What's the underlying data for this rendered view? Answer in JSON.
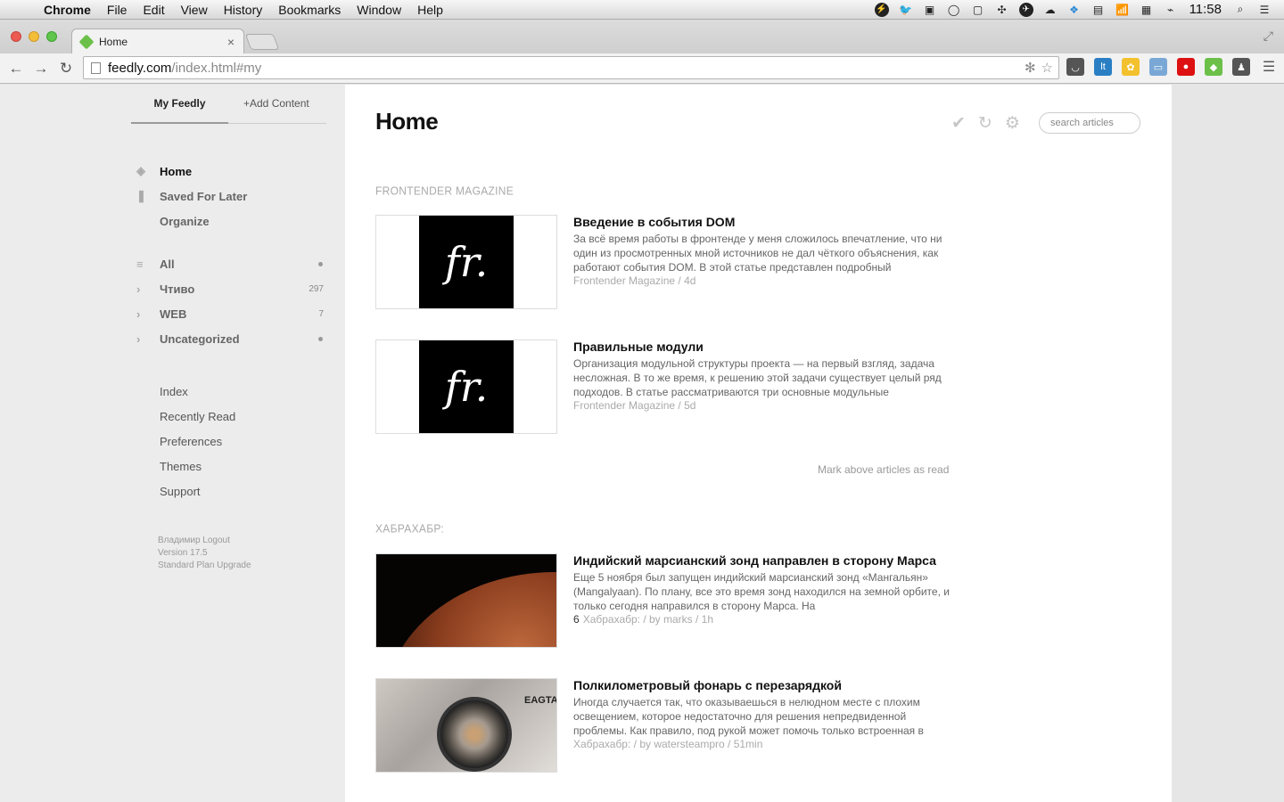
{
  "menubar": {
    "app": "Chrome",
    "items": [
      "File",
      "Edit",
      "View",
      "History",
      "Bookmarks",
      "Window",
      "Help"
    ],
    "clock": "11:58"
  },
  "browser": {
    "tab_title": "Home",
    "url_host": "feedly.com",
    "url_path": "/index.html#my"
  },
  "sidebar": {
    "tabs": [
      "My Feedly",
      "+Add Content"
    ],
    "main_nav": [
      "Home",
      "Saved For Later",
      "Organize"
    ],
    "categories": [
      {
        "label": "All",
        "count": ""
      },
      {
        "label": "Чтиво",
        "count": "297"
      },
      {
        "label": "WEB",
        "count": "7"
      },
      {
        "label": "Uncategorized",
        "count": ""
      }
    ],
    "links": [
      "Index",
      "Recently Read",
      "Preferences",
      "Themes",
      "Support"
    ],
    "footer": {
      "user_line": "Владимир Logout",
      "version": "Version 17.5",
      "plan": "Standard Plan Upgrade"
    }
  },
  "main": {
    "title": "Home",
    "search_placeholder": "search articles",
    "sections": [
      {
        "title": "FRONTENDER MAGAZINE",
        "articles": [
          {
            "title": "Введение в события DOM",
            "summary": "За всё время работы в фронтенде у меня сложилось впечатление, что ни один из просмотренных мной источников не дал чёткого объяснения, как работают события DOM. В этой статье представлен подробный",
            "meta": "Frontender Magazine / 4d",
            "engagement": ""
          },
          {
            "title": "Правильные модули",
            "summary": "Организация модульной структуры проекта — на первый взгляд, задача несложная. В то же время, к решению этой задачи существует целый ряд подходов. В статье рассматриваются три основные модульные",
            "meta": "Frontender Magazine / 5d",
            "engagement": ""
          }
        ],
        "mark_read": "Mark above articles as read"
      },
      {
        "title": "ХАБРАХАБР:",
        "articles": [
          {
            "title": "Индийский марсианский зонд направлен в сторону Марса",
            "summary": "Еще 5 ноября был запущен индийский марсианский зонд «Мангальян» (Mangalyaan). По плану, все это время зонд находился на земной орбите, и только сегодня направился в сторону Марса. На",
            "meta": "Хабрахабр: / by marks / 1h",
            "engagement": "6"
          },
          {
            "title": "Полкилометровый фонарь с перезарядкой",
            "summary": "Иногда случается так, что оказываешься в нелюдном месте с плохим освещением, которое недостаточно для решения непредвиденной проблемы. Как правило, под рукой может помочь только встроенная в",
            "meta": "Хабрахабр: / by watersteampro / 51min",
            "engagement": ""
          }
        ]
      }
    ]
  },
  "colors": {
    "feedly_green": "#6cc04a",
    "sidebar_bg": "#ececec",
    "content_bg": "#ffffff"
  }
}
